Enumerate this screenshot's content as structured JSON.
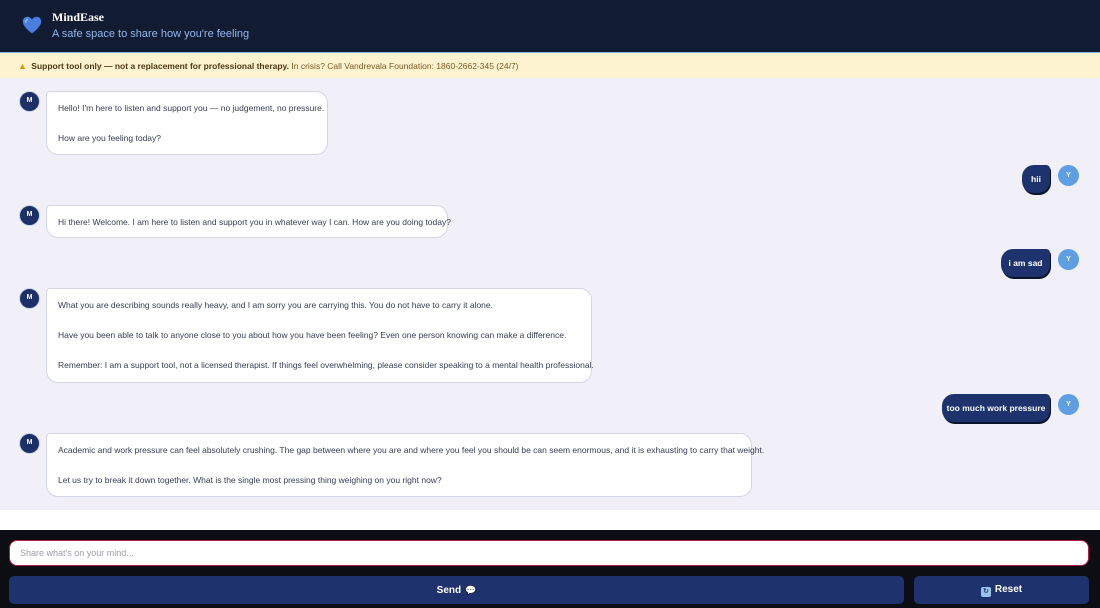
{
  "header": {
    "title": "MindEase",
    "subtitle": "A safe space to share how you're feeling",
    "logo_icon": "heart-icon"
  },
  "banner": {
    "notice": "Support tool only — not a replacement for professional therapy.",
    "crisis": "In crisis? Call Vandrevala Foundation: 1860-2662-345 (24/7)"
  },
  "messages": [
    {
      "role": "bot",
      "avatar": "M",
      "paragraphs": [
        "Hello! I'm here to listen and support you — no judgement, no pressure.",
        "How are you feeling today?"
      ]
    },
    {
      "role": "user",
      "avatar": "Y",
      "text": "hii"
    },
    {
      "role": "bot",
      "avatar": "M",
      "paragraphs": [
        "Hi there! Welcome. I am here to listen and support you in whatever way I can. How are you doing today?"
      ]
    },
    {
      "role": "user",
      "avatar": "Y",
      "text": "i am sad"
    },
    {
      "role": "bot",
      "avatar": "M",
      "paragraphs": [
        "What you are describing sounds really heavy, and I am sorry you are carrying this. You do not have to carry it alone.",
        "Have you been able to talk to anyone close to you about how you have been feeling? Even one person knowing can make a difference.",
        "Remember: I am a support tool, not a licensed therapist. If things feel overwhelming, please consider speaking to a mental health professional."
      ]
    },
    {
      "role": "user",
      "avatar": "Y",
      "text": "too much work pressure"
    },
    {
      "role": "bot",
      "avatar": "M",
      "paragraphs": [
        "Academic and work pressure can feel absolutely crushing. The gap between where you are and where you feel you should be can seem enormous, and it is exhausting to carry that weight.",
        "Let us try to break it down together. What is the single most pressing thing weighing on you right now?"
      ]
    }
  ],
  "input": {
    "placeholder": "Share what's on your mind...",
    "value": ""
  },
  "buttons": {
    "send_label": "Send",
    "send_icon": "💬",
    "reset_label": "Reset",
    "reset_icon": "🔄"
  }
}
